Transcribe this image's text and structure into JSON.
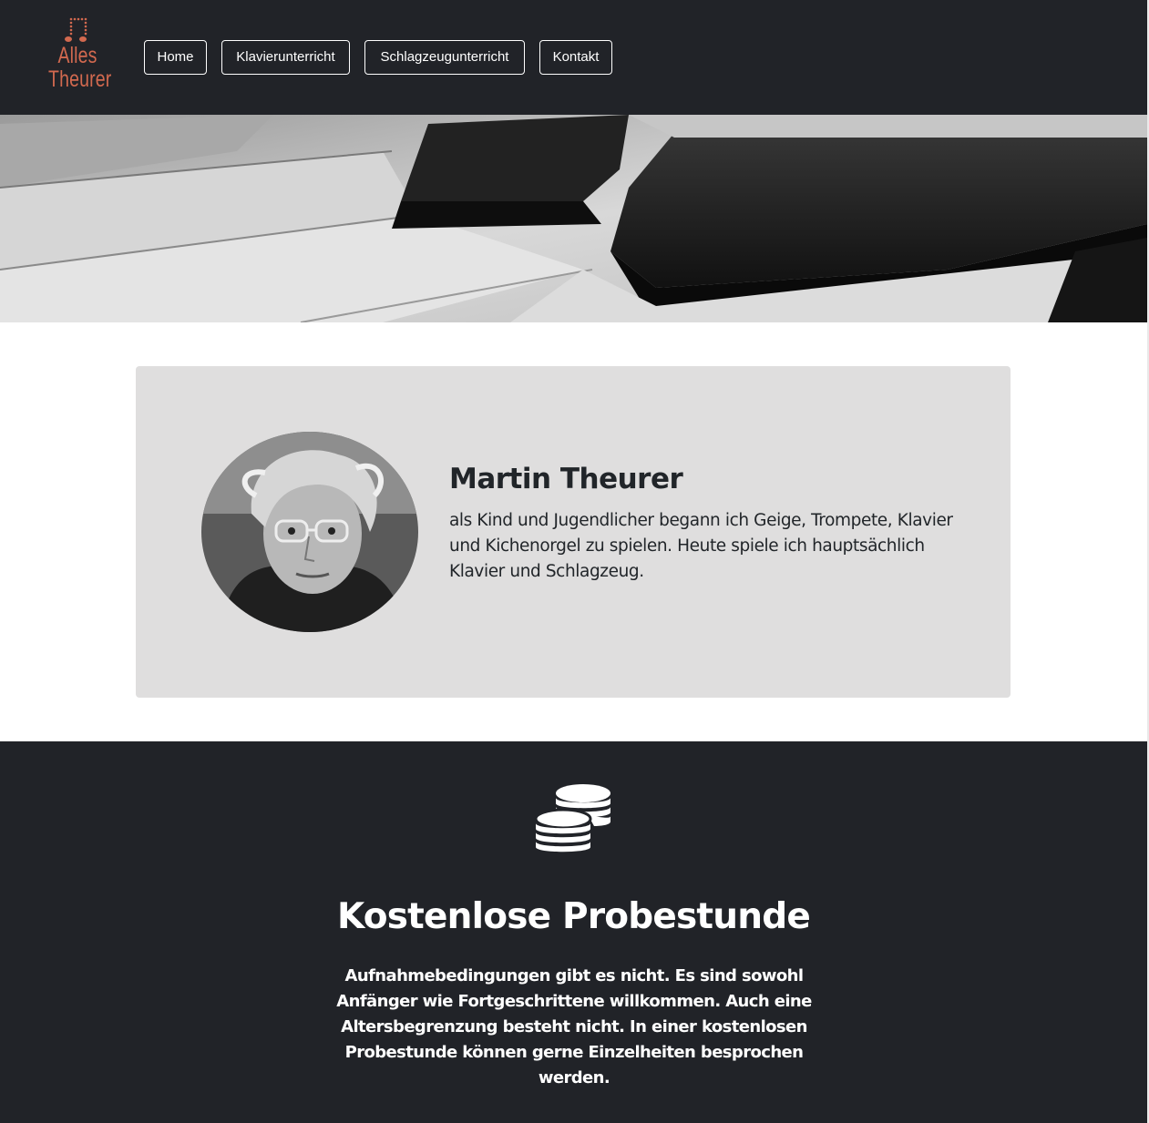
{
  "brand": {
    "logo_line1": "Alles",
    "logo_line2": "Theurer",
    "logo_icon": "music-note-icon",
    "accent_color": "#d2694f"
  },
  "nav": {
    "items": [
      {
        "label": "Home"
      },
      {
        "label": "Klavierunterricht"
      },
      {
        "label": "Schlagzeugunterricht"
      },
      {
        "label": "Kontakt"
      }
    ]
  },
  "hero": {
    "image": "piano-keys-photo"
  },
  "profile": {
    "image": "portrait-photo",
    "name": "Martin Theurer",
    "bio": "als Kind und Jugendlicher begann ich Geige, Trompete, Klavier und Kichenorgel zu spielen. Heute spiele ich hauptsächlich Klavier und Schlagzeug."
  },
  "promo": {
    "icon": "coins-icon",
    "title": "Kostenlose Probestunde",
    "text": "Aufnahmebedingungen gibt es nicht. Es sind sowohl Anfänger wie Fortgeschrittene willkommen. Auch eine Altersbegrenzung besteht nicht. In einer kostenlosen Probestunde können gerne Einzelheiten besprochen werden."
  },
  "colors": {
    "navbar_bg": "#212328",
    "card_bg": "#dfdede",
    "text_dark": "#212529"
  }
}
